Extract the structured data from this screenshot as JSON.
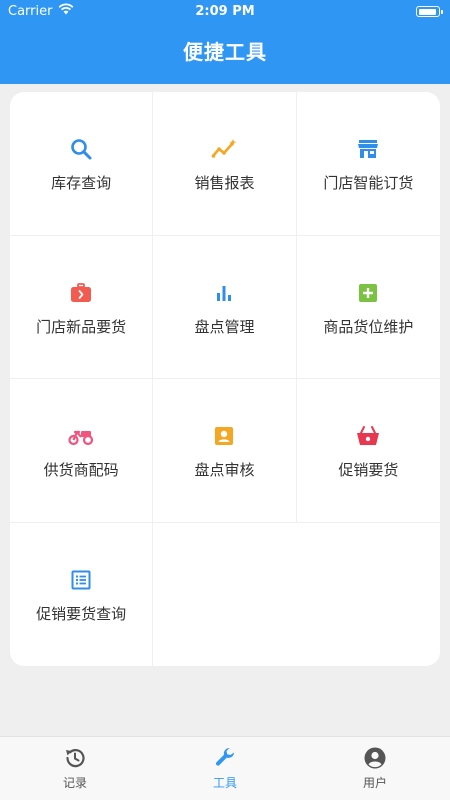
{
  "status_bar": {
    "carrier": "Carrier",
    "time": "2:09 PM"
  },
  "header": {
    "title": "便捷工具"
  },
  "tools": [
    {
      "label": "库存查询",
      "icon": "search-icon",
      "color": "#2f8ee8"
    },
    {
      "label": "销售报表",
      "icon": "trend-chart-icon",
      "color": "#f5a623"
    },
    {
      "label": "门店智能订货",
      "icon": "store-icon",
      "color": "#2f8ee8"
    },
    {
      "label": "门店新品要货",
      "icon": "briefcase-icon",
      "color": "#f25b4f"
    },
    {
      "label": "盘点管理",
      "icon": "bar-chart-icon",
      "color": "#2f8ee8"
    },
    {
      "label": "商品货位维护",
      "icon": "plus-square-icon",
      "color": "#7cc242"
    },
    {
      "label": "供货商配码",
      "icon": "tricycle-icon",
      "color": "#f2547e"
    },
    {
      "label": "盘点审核",
      "icon": "contact-card-icon",
      "color": "#f5a623"
    },
    {
      "label": "促销要货",
      "icon": "basket-icon",
      "color": "#e8384f"
    },
    {
      "label": "促销要货查询",
      "icon": "list-doc-icon",
      "color": "#2f8ee8"
    }
  ],
  "tabbar": {
    "items": [
      {
        "label": "记录",
        "icon": "history-icon",
        "active": false
      },
      {
        "label": "工具",
        "icon": "wrench-icon",
        "active": true
      },
      {
        "label": "用户",
        "icon": "user-icon",
        "active": false
      }
    ],
    "active_color": "#2f97f3",
    "inactive_color": "#555555"
  }
}
